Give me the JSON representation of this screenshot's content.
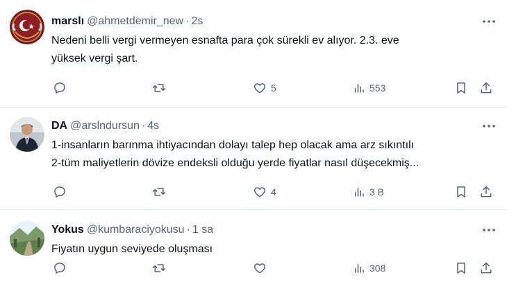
{
  "tweets": [
    {
      "display_name": "marslı",
      "handle": "@ahmetdemir_new",
      "separator": "·",
      "time": "2s",
      "lines": [
        "Nedeni belli vergi vermeyen esnafta para çok sürekli ev alıyor. 2.3. eve",
        "yüksek vergi şart."
      ],
      "reply_count": "",
      "retweet_count": "",
      "like_count": "5",
      "view_count": "553",
      "avatar_icon": "red-crest-avatar-icon"
    },
    {
      "display_name": "DA",
      "handle": "@arslndursun",
      "separator": "·",
      "time": "4s",
      "lines": [
        "1-insanların barınma ihtiyacından dolayı talep hep olacak ama arz sıkıntılı",
        "2-tüm maliyetlerin dövize endeksli olduğu yerde fiyatlar nasıl düşecekmiş..."
      ],
      "reply_count": "",
      "retweet_count": "",
      "like_count": "4",
      "view_count": "3 B",
      "avatar_icon": "person-photo-avatar-icon"
    },
    {
      "display_name": "Yokus",
      "handle": "@kumbaraciyokusu",
      "separator": "·",
      "time": "1 sa",
      "lines": [
        "Fiyatın uygun seviyede oluşması"
      ],
      "reply_count": "",
      "retweet_count": "",
      "like_count": "",
      "view_count": "308",
      "avatar_icon": "landscape-photo-avatar-icon"
    }
  ],
  "colors": {
    "text_primary": "#0f1419",
    "text_secondary": "#536471",
    "divider": "#e6ecf0"
  }
}
